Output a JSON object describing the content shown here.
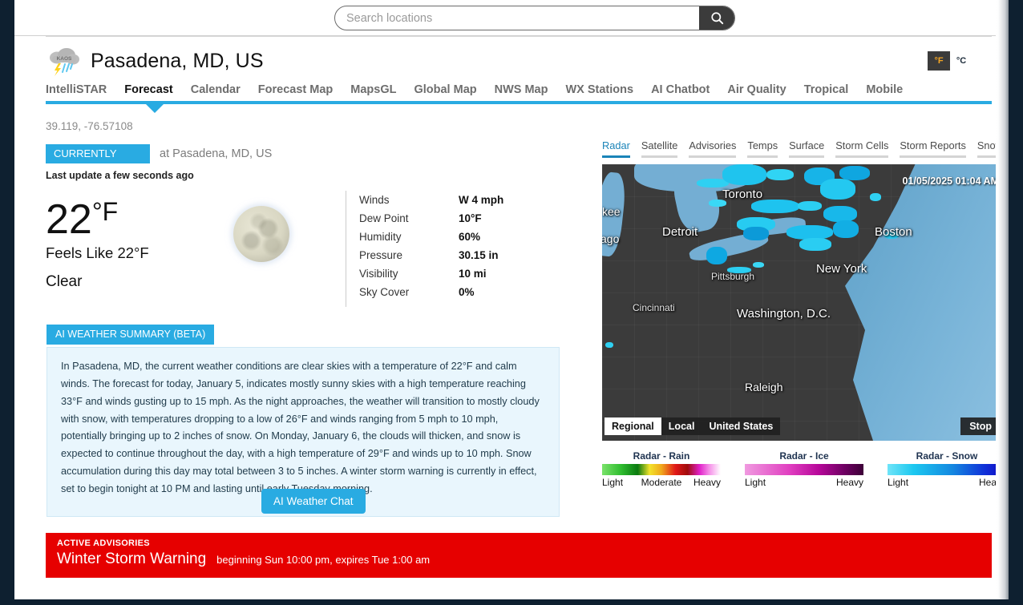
{
  "search": {
    "placeholder": "Search locations",
    "value": "",
    "icon": "search-icon"
  },
  "header": {
    "logo_text": "KAOS",
    "city_title": "Pasadena, MD, US",
    "units": {
      "fahrenheit": "°F",
      "celsius": "°C",
      "selected": "°F"
    }
  },
  "main_nav": {
    "tabs": [
      {
        "label": "IntelliSTAR",
        "active": false
      },
      {
        "label": "Forecast",
        "active": true
      },
      {
        "label": "Calendar",
        "active": false
      },
      {
        "label": "Forecast Map",
        "active": false
      },
      {
        "label": "MapsGL",
        "active": false
      },
      {
        "label": "Global Map",
        "active": false
      },
      {
        "label": "NWS Map",
        "active": false
      },
      {
        "label": "WX Stations",
        "active": false
      },
      {
        "label": "AI Chatbot",
        "active": false
      },
      {
        "label": "Air Quality",
        "active": false
      },
      {
        "label": "Tropical",
        "active": false
      },
      {
        "label": "Mobile",
        "active": false
      }
    ],
    "accent_color": "#29abe2"
  },
  "current": {
    "coordinates": "39.119, -76.57108",
    "badge": "CURRENTLY",
    "location_suffix": "at Pasadena, MD, US",
    "last_update": "Last update a few seconds ago",
    "temperature": "22",
    "temperature_unit": "°F",
    "feels_like": "Feels Like 22°F",
    "condition": "Clear",
    "moon_icon": "full-moon-icon",
    "details": [
      {
        "label": "Winds",
        "value": "W 4 mph"
      },
      {
        "label": "Dew Point",
        "value": "10°F"
      },
      {
        "label": "Humidity",
        "value": "60%"
      },
      {
        "label": "Pressure",
        "value": "30.15 in"
      },
      {
        "label": "Visibility",
        "value": "10 mi"
      },
      {
        "label": "Sky Cover",
        "value": "0%"
      }
    ]
  },
  "ai_summary": {
    "badge": "AI WEATHER SUMMARY (BETA)",
    "text": "In Pasadena, MD, the current weather conditions are clear skies with a temperature of 22°F and calm winds. The forecast for today, January 5, indicates mostly sunny skies with a high temperature reaching 33°F and winds gusting up to 15 mph. As the night approaches, the weather will transition to mostly cloudy with snow, with temperatures dropping to a low of 26°F and winds ranging from 5 mph to 10 mph, potentially bringing up to 2 inches of snow. On Monday, January 6, the clouds will thicken, and snow is expected to continue throughout the day, with a high temperature of 29°F and winds up to 10 mph. Snow accumulation during this day may total between 3 to 5 inches. A winter storm warning is currently in effect, set to begin tonight at 10 PM and lasting until early Tuesday morning.",
    "chat_button": "AI Weather Chat"
  },
  "radar": {
    "tabs": [
      {
        "label": "Radar",
        "active": true
      },
      {
        "label": "Satellite",
        "active": false
      },
      {
        "label": "Advisories",
        "active": false
      },
      {
        "label": "Temps",
        "active": false
      },
      {
        "label": "Surface",
        "active": false
      },
      {
        "label": "Storm Cells",
        "active": false
      },
      {
        "label": "Storm Reports",
        "active": false
      },
      {
        "label": "Snow",
        "active": false
      }
    ],
    "timestamp": "01/05/2025 01:04 AM",
    "cities": [
      "Toronto",
      "Detroit",
      "Boston",
      "New York",
      "Pittsburgh",
      "Cincinnati",
      "Washington, D.C.",
      "Raleigh",
      "kee",
      "ago"
    ],
    "scope_buttons": [
      {
        "label": "Regional",
        "selected": true
      },
      {
        "label": "Local",
        "selected": false
      },
      {
        "label": "United States",
        "selected": false
      }
    ],
    "playback_button": "Stop",
    "legends": [
      {
        "title": "Radar - Rain",
        "low": "Light",
        "mid": "Moderate",
        "high": "Heavy"
      },
      {
        "title": "Radar - Ice",
        "low": "Light",
        "mid": "",
        "high": "Heavy"
      },
      {
        "title": "Radar - Snow",
        "low": "Light",
        "mid": "",
        "high": "Heavy"
      }
    ]
  },
  "advisory": {
    "heading": "ACTIVE ADVISORIES",
    "title": "Winter Storm Warning",
    "detail": "beginning Sun 10:00 pm, expires Tue 1:00 am",
    "color": "#e60000"
  }
}
